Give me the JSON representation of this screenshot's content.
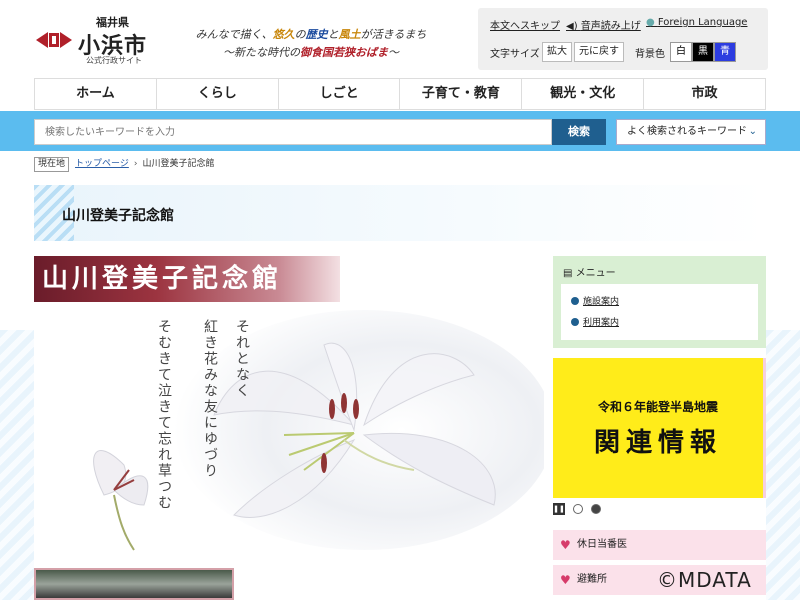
{
  "header": {
    "prefecture": "福井県",
    "city": "小浜市",
    "site_type": "公式行政サイト",
    "tagline": {
      "l1_a": "みんなで描く、",
      "l1_b": "悠久",
      "l1_c": "の",
      "l1_d": "歴史",
      "l1_e": "と",
      "l1_f": "風土",
      "l1_g": "が活きるまち",
      "l2_a": "～新たな時代の",
      "l2_b": "御食国若狭おばま",
      "l2_c": "～"
    },
    "skip_link": "本文へスキップ",
    "read_aloud": "音声読み上げ",
    "foreign_language": "Foreign Language",
    "font_size_label": "文字サイズ",
    "font_enlarge": "拡大",
    "font_reset": "元に戻す",
    "bg_label": "背景色",
    "bg_white": "白",
    "bg_black": "黒",
    "bg_blue": "青"
  },
  "nav": {
    "items": [
      "ホーム",
      "くらし",
      "しごと",
      "子育て・教育",
      "観光・文化",
      "市政"
    ]
  },
  "search": {
    "placeholder": "検索したいキーワードを入力",
    "button": "検索",
    "keywords_button": "よく検索されるキーワード"
  },
  "breadcrumb": {
    "here": "現在地",
    "top": "トップページ",
    "separator": "›",
    "current": "山川登美子記念館"
  },
  "page": {
    "title": "山川登美子記念館",
    "banner_text": "山川登美子記念館",
    "poem": [
      "それとなく",
      "紅き花みな友にゆづり",
      "そむきて泣きて忘れ草つむ"
    ]
  },
  "sidebar": {
    "menu_title": "メニュー",
    "menu_links": [
      "施設案内",
      "利用案内"
    ],
    "quake_line1": "令和６年能登半島地震",
    "quake_line2": "関連情報",
    "links": [
      "休日当番医",
      "避難所"
    ]
  },
  "watermark": "©MDATA",
  "colors": {
    "search_band": "#5bbcef",
    "search_button": "#1f5f8f",
    "menu_bg": "#d9efd3",
    "quake_bg": "#ffec1a",
    "pink_button": "#fbe1ea"
  }
}
